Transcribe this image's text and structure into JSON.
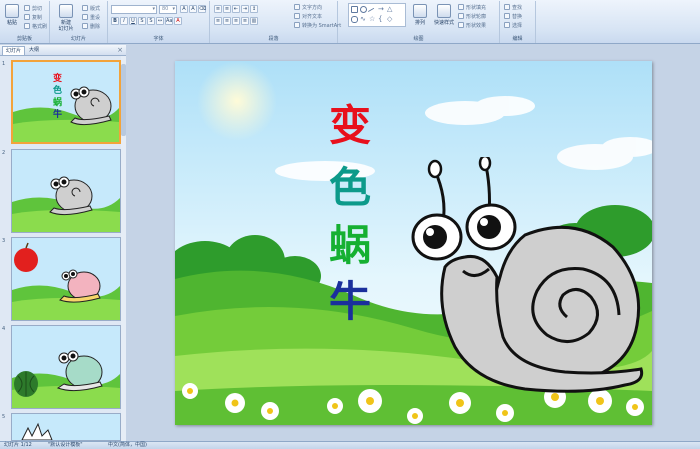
{
  "ribbon": {
    "clipboard": {
      "label": "剪贴板",
      "paste": "粘贴",
      "cut": "剪切",
      "copy": "复制",
      "format_painter": "格式刷"
    },
    "slides": {
      "label": "幻灯片",
      "new_slide": "新建\n幻灯片",
      "layout": "版式",
      "reset": "重设",
      "delete": "删除"
    },
    "font": {
      "label": "字体",
      "font_size": "80"
    },
    "paragraph": {
      "label": "段落",
      "text_direction": "文字方向",
      "align_text": "对齐文本",
      "smartart": "转换为 SmartArt"
    },
    "drawing": {
      "label": "绘图",
      "arrange": "排列",
      "quick_styles": "快速样式",
      "shape_fill": "形状填充",
      "shape_outline": "形状轮廓",
      "shape_effects": "形状效果"
    },
    "editing": {
      "label": "编辑",
      "find": "查找",
      "replace": "替换",
      "select": "选择"
    }
  },
  "left_pane": {
    "tab_slides": "幻灯片",
    "tab_outline": "大纲",
    "close": "×",
    "thumbs": [
      {
        "num": "1"
      },
      {
        "num": "2"
      },
      {
        "num": "3"
      },
      {
        "num": "4"
      },
      {
        "num": "5"
      }
    ]
  },
  "slide": {
    "title_chars": [
      "变",
      "色",
      "蜗",
      "牛"
    ],
    "title_colors": [
      "#e8101c",
      "#0c9a8a",
      "#16b032",
      "#1a2f9c"
    ]
  },
  "statusbar": {
    "slide_count": "幻灯片 1/12",
    "theme": "\"默认设计模板\"",
    "language": "中文(简体，中国)"
  }
}
